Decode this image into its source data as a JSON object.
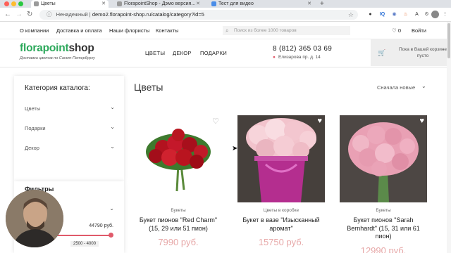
{
  "browser": {
    "tabs": [
      {
        "label": "Цветы",
        "active": true
      },
      {
        "label": "FlorapointShop - Дэмо версия..."
      },
      {
        "label": "Тест для видео"
      }
    ],
    "new_tab": "+",
    "security_label": "Ненадежный",
    "url": "demo2.florapoint-shop.ru/catalog/category?id=5",
    "icons": [
      "back-icon",
      "forward-icon",
      "reload-icon",
      "info-icon",
      "star-icon"
    ]
  },
  "colors": {
    "brand_green": "#2ba85a",
    "accent_pink": "#e05a6a",
    "price_pink": "#e7a8a8"
  },
  "topnav": {
    "links": [
      "О компании",
      "Доставка и оплата",
      "Наши флористы",
      "Контакты"
    ],
    "search_placeholder": "Поиск из более 1000 товаров",
    "favorites_count": "0",
    "login": "Войти"
  },
  "header": {
    "logo_part1": "florapoint",
    "logo_part2": "shop",
    "tagline": "Доставка цветов по Санкт-Петербургу",
    "nav": [
      "ЦВЕТЫ",
      "ДЕКОР",
      "ПОДАРКИ"
    ],
    "phone": "8 (812) 365 03 69",
    "address": "Елизарова пр. д. 14",
    "cart_text": "Пока в Вашей корзине пусто"
  },
  "sidebar": {
    "title": "Категория каталога:",
    "categories": [
      "Цветы",
      "Подарки",
      "Декор"
    ]
  },
  "filters": {
    "title": "Фильтры",
    "max_price": "44790 руб.",
    "range_tooltip": "2500 - 4000"
  },
  "main": {
    "title": "Цветы",
    "sort_label": "Сначала новые"
  },
  "products": [
    {
      "category": "Букеты",
      "name": "Букет пионов \"Red Charm\" (15, 29 или 51 пион)",
      "price": "7990 руб."
    },
    {
      "category": "Цветы в коробке",
      "name": "Букет в вазе \"Изысканный аромат\"",
      "price": "15750 руб."
    },
    {
      "category": "Букеты",
      "name": "Букет пионов \"Sarah Bernhardt\" (15, 31 или 61 пион)",
      "price": "12990 руб."
    }
  ]
}
